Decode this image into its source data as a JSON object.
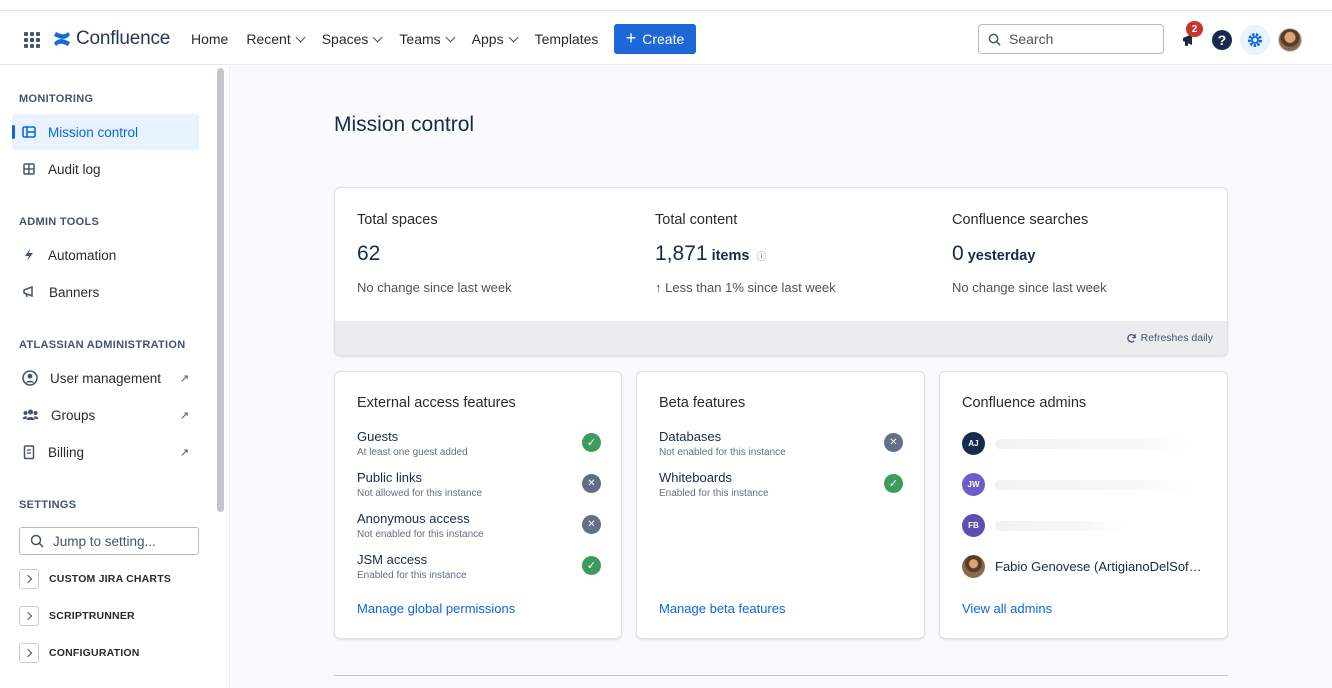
{
  "topbar": {
    "app_name": "Confluence",
    "nav": [
      {
        "label": "Home",
        "dropdown": false
      },
      {
        "label": "Recent",
        "dropdown": true
      },
      {
        "label": "Spaces",
        "dropdown": true
      },
      {
        "label": "Teams",
        "dropdown": true
      },
      {
        "label": "Apps",
        "dropdown": true
      },
      {
        "label": "Templates",
        "dropdown": false
      }
    ],
    "create_label": "Create",
    "search_placeholder": "Search",
    "notification_count": "2",
    "help_glyph": "?"
  },
  "sidebar": {
    "sections": {
      "monitoring": "MONITORING",
      "admin_tools": "ADMIN TOOLS",
      "atlassian_admin": "ATLASSIAN ADMINISTRATION",
      "settings": "SETTINGS"
    },
    "items": {
      "mission_control": "Mission control",
      "audit_log": "Audit log",
      "automation": "Automation",
      "banners": "Banners",
      "user_management": "User management",
      "groups": "Groups",
      "billing": "Billing"
    },
    "external_glyph": "↗",
    "jump_placeholder": "Jump to setting...",
    "expandables": [
      "CUSTOM JIRA CHARTS",
      "SCRIPTRUNNER",
      "CONFIGURATION"
    ]
  },
  "main": {
    "title": "Mission control",
    "stats": [
      {
        "label": "Total spaces",
        "value": "62",
        "unit": "",
        "change": "No change since last week"
      },
      {
        "label": "Total content",
        "value": "1,871",
        "unit": "items",
        "change": "↑ Less than 1% since last week"
      },
      {
        "label": "Confluence searches",
        "value": "0",
        "unit": "yesterday",
        "change": "No change since last week"
      }
    ],
    "refresh_label": "Refreshes daily",
    "external_access": {
      "title": "External access features",
      "rows": [
        {
          "name": "Guests",
          "desc": "At least one guest added",
          "status": "ok"
        },
        {
          "name": "Public links",
          "desc": "Not allowed for this instance",
          "status": "no"
        },
        {
          "name": "Anonymous access",
          "desc": "Not enabled for this instance",
          "status": "no"
        },
        {
          "name": "JSM access",
          "desc": "Enabled for this instance",
          "status": "ok"
        }
      ],
      "link": "Manage global permissions"
    },
    "beta": {
      "title": "Beta features",
      "rows": [
        {
          "name": "Databases",
          "desc": "Not enabled for this instance",
          "status": "no"
        },
        {
          "name": "Whiteboards",
          "desc": "Enabled for this instance",
          "status": "ok"
        }
      ],
      "link": "Manage beta features"
    },
    "admins": {
      "title": "Confluence admins",
      "list": [
        {
          "initials": "AJ",
          "color": "#172b4d",
          "name": ""
        },
        {
          "initials": "JW",
          "color": "#6e5dc6",
          "name": ""
        },
        {
          "initials": "FB",
          "color": "#5e4db2",
          "name": ""
        },
        {
          "initials": "",
          "color": "#8a6a4f",
          "name": "Fabio Genovese (ArtigianoDelSof…"
        }
      ],
      "link": "View all admins"
    }
  },
  "colors": {
    "accent": "#1d67d8",
    "success": "#3f9a5d",
    "neutral_status": "#626f86",
    "link": "#0c66e4"
  }
}
